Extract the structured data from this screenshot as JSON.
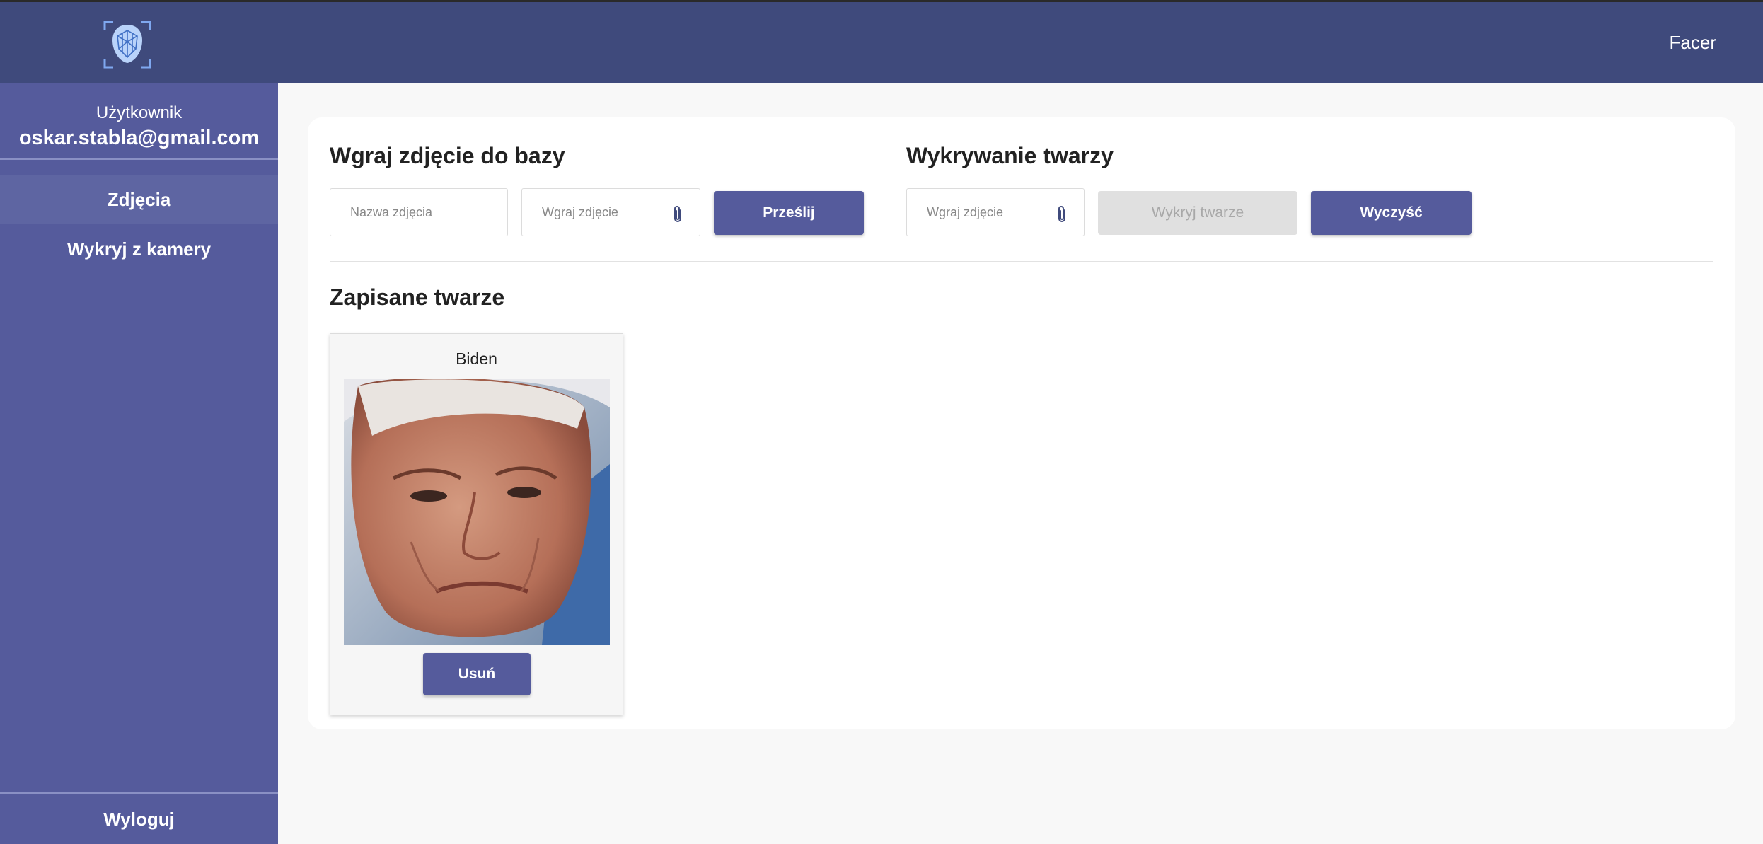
{
  "header": {
    "app_name": "Facer",
    "logo_icon": "face-scan-icon"
  },
  "sidebar": {
    "user_caption": "Użytkownik",
    "user_email": "oskar.stabla@gmail.com",
    "items": [
      {
        "label": "Zdjęcia",
        "active": true
      },
      {
        "label": "Wykryj z kamery",
        "active": false
      }
    ],
    "logout_label": "Wyloguj"
  },
  "upload": {
    "title": "Wgraj zdjęcie do bazy",
    "name_placeholder": "Nazwa zdjęcia",
    "file_placeholder": "Wgraj zdjęcie",
    "submit_label": "Prześlij",
    "file_icon": "paperclip-icon"
  },
  "detect": {
    "title": "Wykrywanie twarzy",
    "file_placeholder": "Wgraj zdjęcie",
    "detect_label": "Wykryj twarze",
    "clear_label": "Wyczyść",
    "file_icon": "paperclip-icon"
  },
  "saved": {
    "title": "Zapisane twarze",
    "faces": [
      {
        "name": "Biden",
        "delete_label": "Usuń"
      }
    ]
  },
  "colors": {
    "header": "#3f4a7c",
    "sidebar": "#555b9c",
    "button": "#555b9c",
    "disabled_button": "#e0e0e0"
  }
}
